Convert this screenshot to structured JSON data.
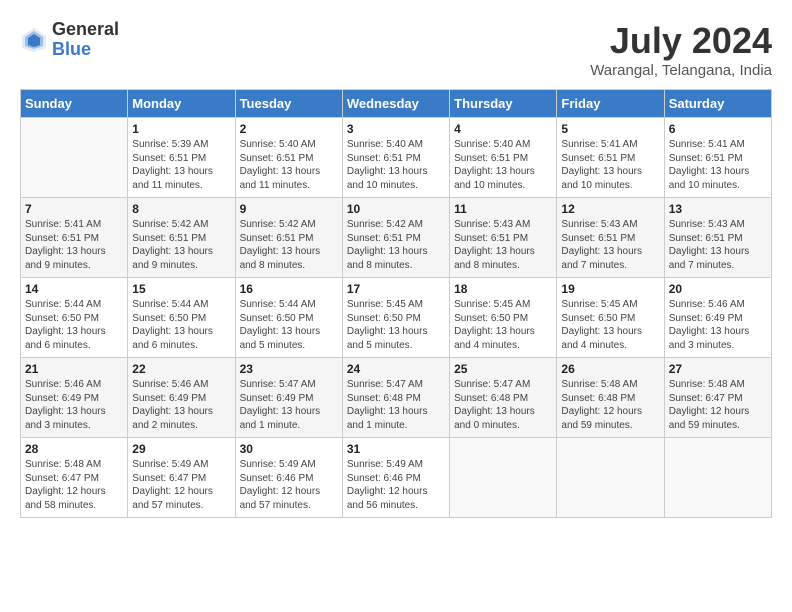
{
  "header": {
    "logo_general": "General",
    "logo_blue": "Blue",
    "month_year": "July 2024",
    "location": "Warangal, Telangana, India"
  },
  "days_of_week": [
    "Sunday",
    "Monday",
    "Tuesday",
    "Wednesday",
    "Thursday",
    "Friday",
    "Saturday"
  ],
  "weeks": [
    [
      {
        "day": "",
        "info": ""
      },
      {
        "day": "1",
        "info": "Sunrise: 5:39 AM\nSunset: 6:51 PM\nDaylight: 13 hours\nand 11 minutes."
      },
      {
        "day": "2",
        "info": "Sunrise: 5:40 AM\nSunset: 6:51 PM\nDaylight: 13 hours\nand 11 minutes."
      },
      {
        "day": "3",
        "info": "Sunrise: 5:40 AM\nSunset: 6:51 PM\nDaylight: 13 hours\nand 10 minutes."
      },
      {
        "day": "4",
        "info": "Sunrise: 5:40 AM\nSunset: 6:51 PM\nDaylight: 13 hours\nand 10 minutes."
      },
      {
        "day": "5",
        "info": "Sunrise: 5:41 AM\nSunset: 6:51 PM\nDaylight: 13 hours\nand 10 minutes."
      },
      {
        "day": "6",
        "info": "Sunrise: 5:41 AM\nSunset: 6:51 PM\nDaylight: 13 hours\nand 10 minutes."
      }
    ],
    [
      {
        "day": "7",
        "info": "Sunrise: 5:41 AM\nSunset: 6:51 PM\nDaylight: 13 hours\nand 9 minutes."
      },
      {
        "day": "8",
        "info": "Sunrise: 5:42 AM\nSunset: 6:51 PM\nDaylight: 13 hours\nand 9 minutes."
      },
      {
        "day": "9",
        "info": "Sunrise: 5:42 AM\nSunset: 6:51 PM\nDaylight: 13 hours\nand 8 minutes."
      },
      {
        "day": "10",
        "info": "Sunrise: 5:42 AM\nSunset: 6:51 PM\nDaylight: 13 hours\nand 8 minutes."
      },
      {
        "day": "11",
        "info": "Sunrise: 5:43 AM\nSunset: 6:51 PM\nDaylight: 13 hours\nand 8 minutes."
      },
      {
        "day": "12",
        "info": "Sunrise: 5:43 AM\nSunset: 6:51 PM\nDaylight: 13 hours\nand 7 minutes."
      },
      {
        "day": "13",
        "info": "Sunrise: 5:43 AM\nSunset: 6:51 PM\nDaylight: 13 hours\nand 7 minutes."
      }
    ],
    [
      {
        "day": "14",
        "info": "Sunrise: 5:44 AM\nSunset: 6:50 PM\nDaylight: 13 hours\nand 6 minutes."
      },
      {
        "day": "15",
        "info": "Sunrise: 5:44 AM\nSunset: 6:50 PM\nDaylight: 13 hours\nand 6 minutes."
      },
      {
        "day": "16",
        "info": "Sunrise: 5:44 AM\nSunset: 6:50 PM\nDaylight: 13 hours\nand 5 minutes."
      },
      {
        "day": "17",
        "info": "Sunrise: 5:45 AM\nSunset: 6:50 PM\nDaylight: 13 hours\nand 5 minutes."
      },
      {
        "day": "18",
        "info": "Sunrise: 5:45 AM\nSunset: 6:50 PM\nDaylight: 13 hours\nand 4 minutes."
      },
      {
        "day": "19",
        "info": "Sunrise: 5:45 AM\nSunset: 6:50 PM\nDaylight: 13 hours\nand 4 minutes."
      },
      {
        "day": "20",
        "info": "Sunrise: 5:46 AM\nSunset: 6:49 PM\nDaylight: 13 hours\nand 3 minutes."
      }
    ],
    [
      {
        "day": "21",
        "info": "Sunrise: 5:46 AM\nSunset: 6:49 PM\nDaylight: 13 hours\nand 3 minutes."
      },
      {
        "day": "22",
        "info": "Sunrise: 5:46 AM\nSunset: 6:49 PM\nDaylight: 13 hours\nand 2 minutes."
      },
      {
        "day": "23",
        "info": "Sunrise: 5:47 AM\nSunset: 6:49 PM\nDaylight: 13 hours\nand 1 minute."
      },
      {
        "day": "24",
        "info": "Sunrise: 5:47 AM\nSunset: 6:48 PM\nDaylight: 13 hours\nand 1 minute."
      },
      {
        "day": "25",
        "info": "Sunrise: 5:47 AM\nSunset: 6:48 PM\nDaylight: 13 hours\nand 0 minutes."
      },
      {
        "day": "26",
        "info": "Sunrise: 5:48 AM\nSunset: 6:48 PM\nDaylight: 12 hours\nand 59 minutes."
      },
      {
        "day": "27",
        "info": "Sunrise: 5:48 AM\nSunset: 6:47 PM\nDaylight: 12 hours\nand 59 minutes."
      }
    ],
    [
      {
        "day": "28",
        "info": "Sunrise: 5:48 AM\nSunset: 6:47 PM\nDaylight: 12 hours\nand 58 minutes."
      },
      {
        "day": "29",
        "info": "Sunrise: 5:49 AM\nSunset: 6:47 PM\nDaylight: 12 hours\nand 57 minutes."
      },
      {
        "day": "30",
        "info": "Sunrise: 5:49 AM\nSunset: 6:46 PM\nDaylight: 12 hours\nand 57 minutes."
      },
      {
        "day": "31",
        "info": "Sunrise: 5:49 AM\nSunset: 6:46 PM\nDaylight: 12 hours\nand 56 minutes."
      },
      {
        "day": "",
        "info": ""
      },
      {
        "day": "",
        "info": ""
      },
      {
        "day": "",
        "info": ""
      }
    ]
  ]
}
